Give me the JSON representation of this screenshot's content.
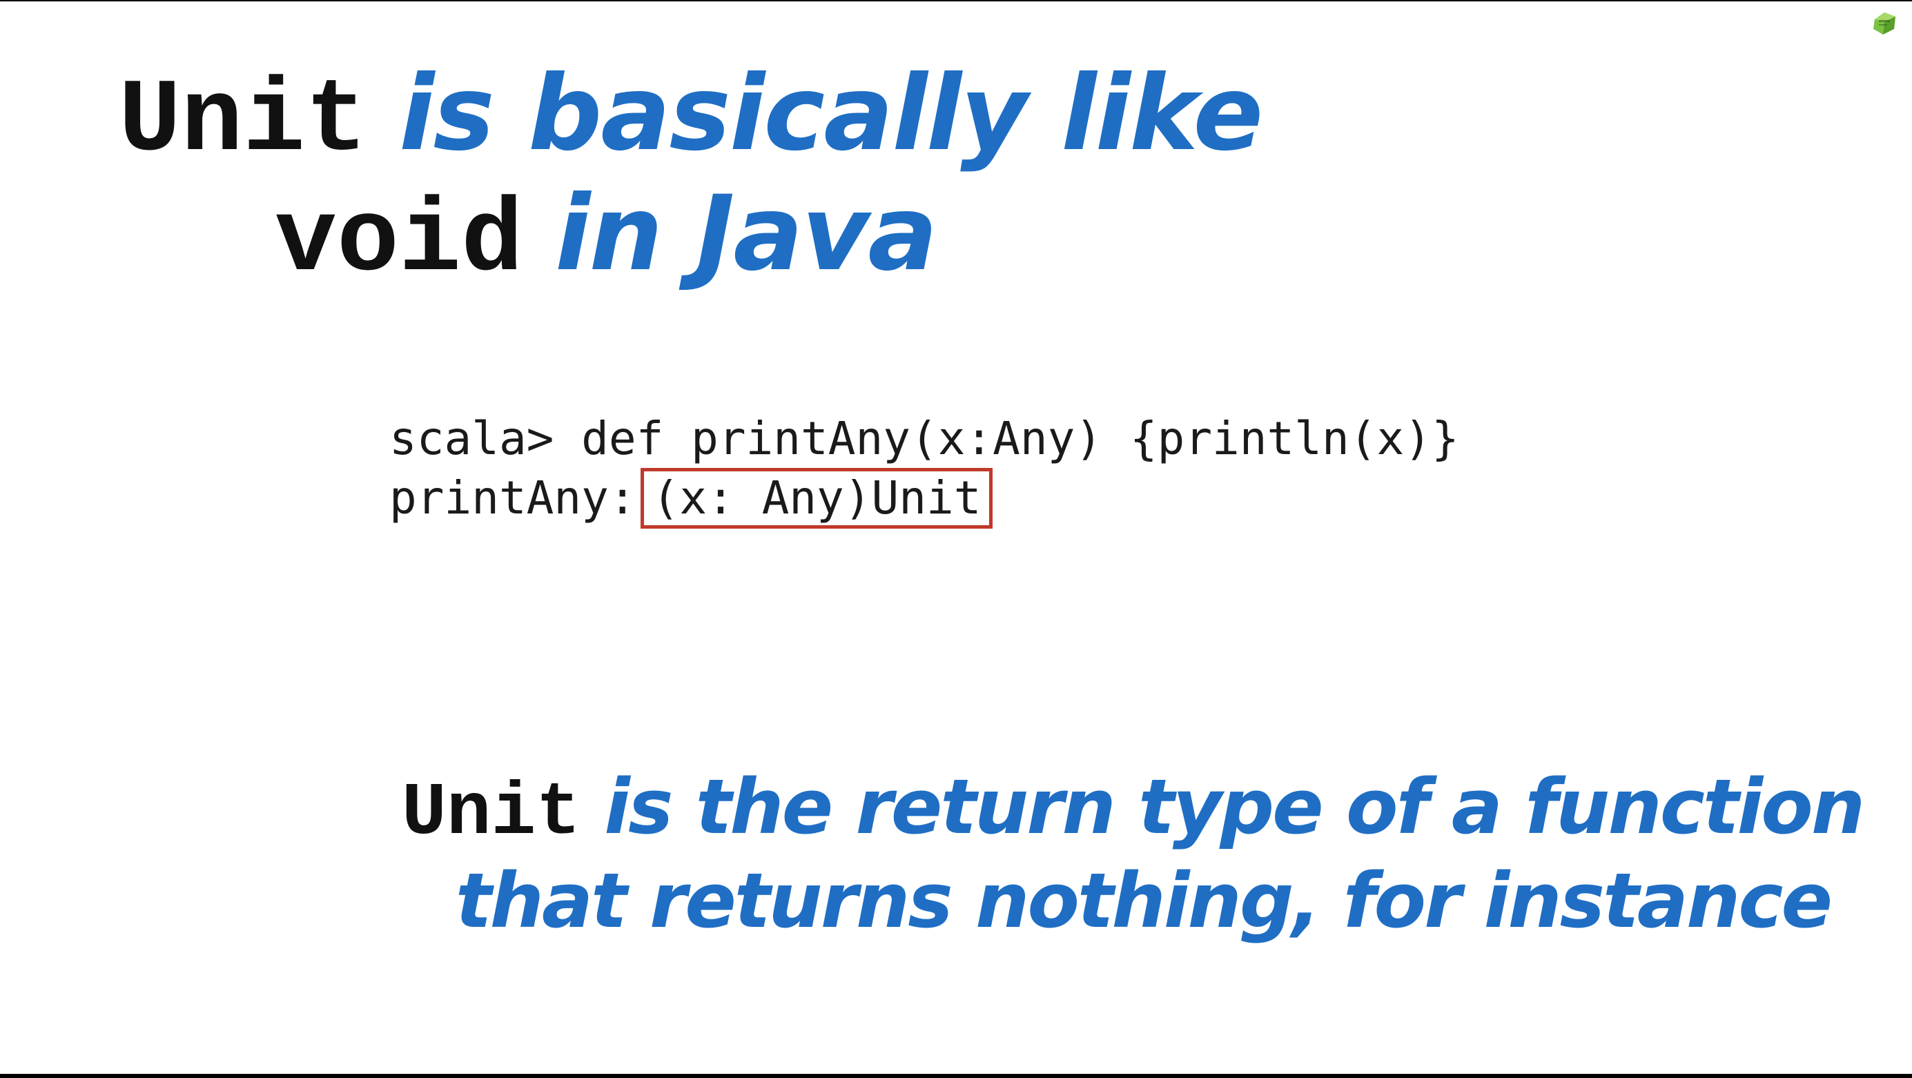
{
  "title": {
    "line1_code": "Unit",
    "line1_text": "is basically like",
    "line2_code": "void",
    "line2_text": "in Java"
  },
  "code_snippet": {
    "line1": "scala> def printAny(x:Any) {println(x)}",
    "line2_prefix": "printAny:",
    "line2_highlight": "(x: Any)Unit"
  },
  "explanation": {
    "line1_code": "Unit",
    "line1_text": "is the return type of a function",
    "line2_text": "that returns nothing, for instance"
  },
  "colors": {
    "accent_blue": "#1f6ec4",
    "highlight_box": "#c0392b",
    "logo_green": "#7cc242"
  },
  "icons": {
    "corner_logo": "green-gem-logo-icon"
  }
}
